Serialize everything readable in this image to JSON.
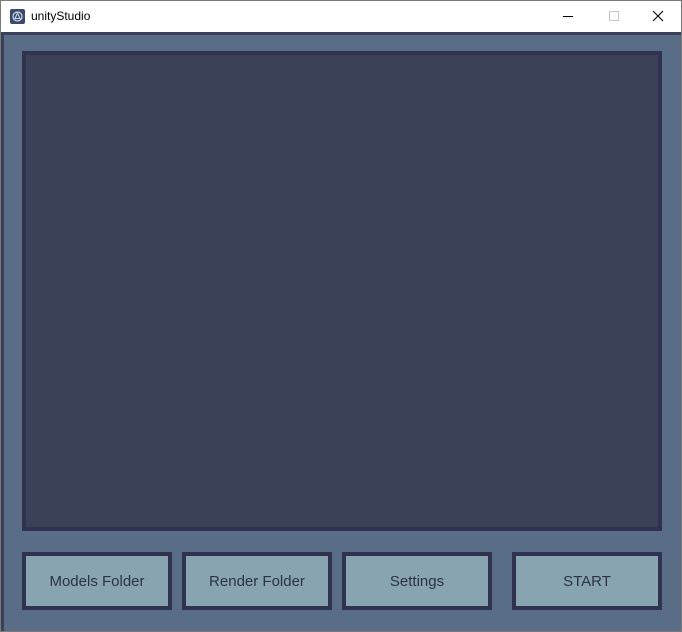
{
  "window": {
    "title": "unityStudio"
  },
  "buttons": {
    "models_folder": "Models Folder",
    "render_folder": "Render Folder",
    "settings": "Settings",
    "start": "START"
  },
  "icons": {
    "app": "unity-app-icon",
    "minimize": "minimize-icon",
    "maximize": "maximize-icon",
    "close": "close-icon"
  },
  "colors": {
    "panel_background": "#5a6d87",
    "viewport_background": "#3a4159",
    "border": "#2f3350",
    "button_background": "#87a4b0",
    "button_text": "#2d3247"
  }
}
